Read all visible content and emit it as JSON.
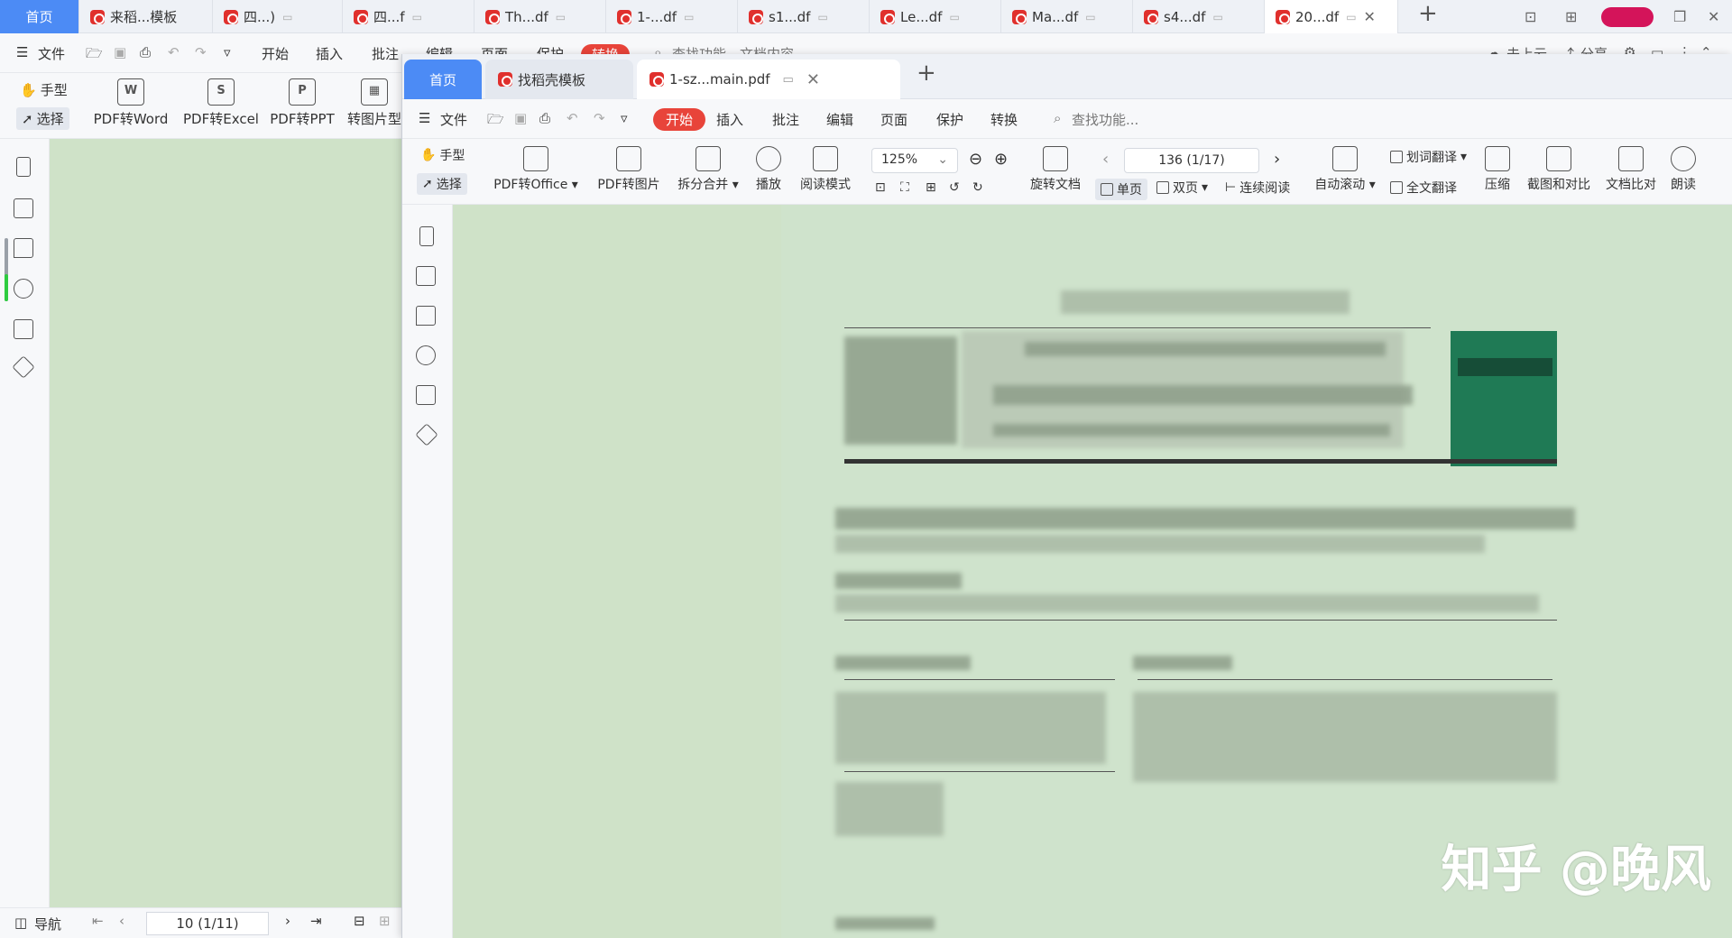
{
  "background_window": {
    "tabs": [
      {
        "label": "首页",
        "type": "home"
      },
      {
        "label": "来稻...模板"
      },
      {
        "label": "四...)"
      },
      {
        "label": "四...f"
      },
      {
        "label": "Th...df"
      },
      {
        "label": "1-...df"
      },
      {
        "label": "s1...df"
      },
      {
        "label": "Le...df"
      },
      {
        "label": "Ma...df"
      },
      {
        "label": "s4...df"
      },
      {
        "label": "20...df",
        "active": true
      }
    ],
    "menu": {
      "file": "文件",
      "start": "开始",
      "insert": "插入",
      "annotate": "批注",
      "edit": "编辑",
      "page": "页面",
      "protect": "保护",
      "convert": "转换",
      "search": "查找功能、文档内容",
      "cloud": "未上云",
      "share": "分享"
    },
    "ribbon": {
      "hand": "手型",
      "select": "选择",
      "pdf_word": "PDF转Word",
      "pdf_excel": "PDF转Excel",
      "pdf_ppt": "PDF转PPT",
      "to_image": "转图片型"
    },
    "status": {
      "nav": "导航",
      "page": "10 (1/11)"
    }
  },
  "foreground_window": {
    "tabs": [
      {
        "label": "首页",
        "type": "home"
      },
      {
        "label": "找稻壳模板"
      },
      {
        "label": "1-sz...main.pdf",
        "active": true
      }
    ],
    "menu": {
      "file": "文件",
      "start": "开始",
      "insert": "插入",
      "annotate": "批注",
      "edit": "编辑",
      "page": "页面",
      "protect": "保护",
      "convert": "转换",
      "search": "查找功能..."
    },
    "ribbon": {
      "hand": "手型",
      "select": "选择",
      "pdf_office": "PDF转Office",
      "pdf_image": "PDF转图片",
      "split_merge": "拆分合并",
      "play": "播放",
      "read_mode": "阅读模式",
      "zoom": "125%",
      "rotate": "旋转文档",
      "page_indicator": "136 (1/17)",
      "single": "单页",
      "double": "双页",
      "continuous": "连续阅读",
      "auto_scroll": "自动滚动",
      "word_translate": "划词翻译",
      "full_translate": "全文翻译",
      "compress": "压缩",
      "screenshot_compare": "截图和对比",
      "doc_compare": "文档比对",
      "read_aloud": "朗读"
    }
  },
  "watermark": "知乎 @晚风",
  "colors": {
    "accent_blue": "#4c8bf5",
    "accent_red": "#e8443a",
    "eye_care_green": "#cfe2c8",
    "cover_green": "#1f7a55"
  }
}
